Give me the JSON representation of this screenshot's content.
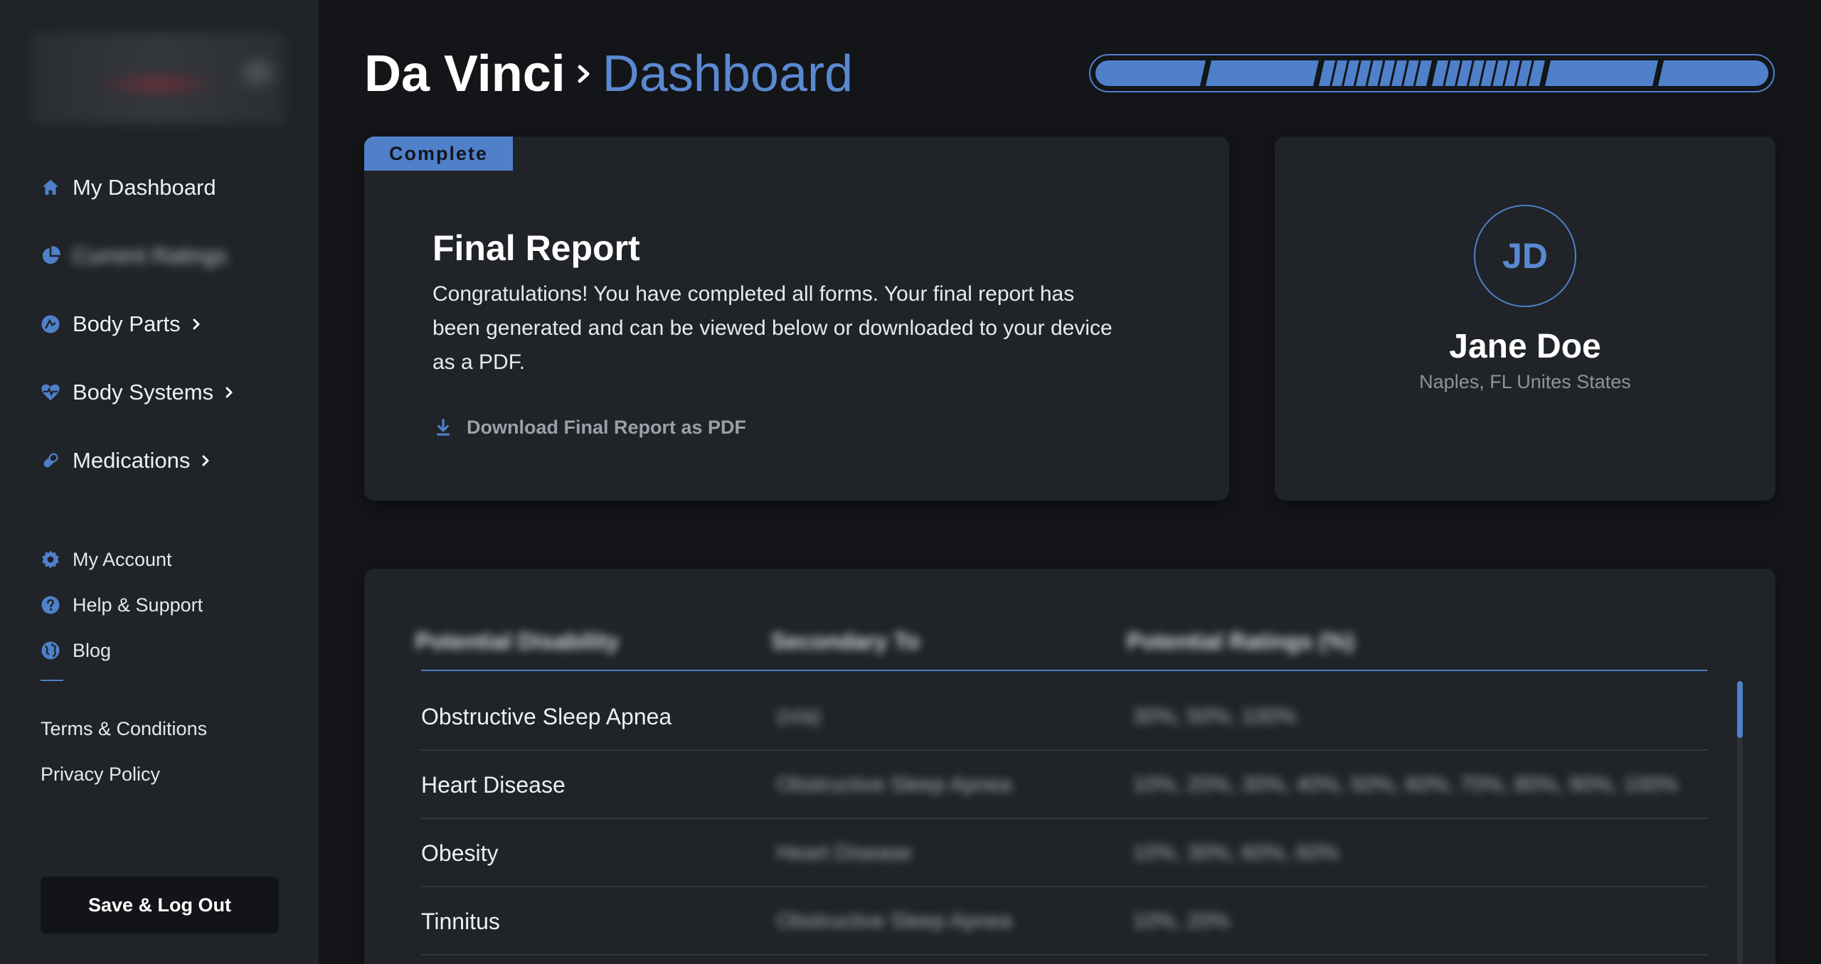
{
  "header": {
    "app_name": "Da Vinci",
    "page_name": "Dashboard",
    "progress_segments": 6,
    "progress_completed": 6
  },
  "sidebar": {
    "items": [
      {
        "label": "My Dashboard",
        "icon": "home-icon",
        "has_chevron": false
      },
      {
        "label": "Current Ratings",
        "icon": "pie-chart-icon",
        "has_chevron": false,
        "blurred": true
      },
      {
        "label": "Body Parts",
        "icon": "body-parts-icon",
        "has_chevron": true
      },
      {
        "label": "Body Systems",
        "icon": "heart-pulse-icon",
        "has_chevron": true
      },
      {
        "label": "Medications",
        "icon": "pill-icon",
        "has_chevron": true
      }
    ],
    "account_items": [
      {
        "label": "My Account",
        "icon": "gear-icon"
      },
      {
        "label": "Help & Support",
        "icon": "question-icon"
      },
      {
        "label": "Blog",
        "icon": "globe-icon"
      }
    ],
    "legal": {
      "terms": "Terms & Conditions",
      "privacy": "Privacy Policy"
    },
    "logout_label": "Save & Log Out"
  },
  "report": {
    "badge": "Complete",
    "title": "Final Report",
    "body": "Congratulations! You have completed all forms. Your final report has been generated and can be viewed below or downloaded to your device as a PDF.",
    "download_label": "Download Final Report as PDF"
  },
  "profile": {
    "initials": "JD",
    "name": "Jane Doe",
    "location": "Naples, FL Unites States"
  },
  "table": {
    "headers": [
      "Potential Disability",
      "Secondary To",
      "Potential Ratings (%)"
    ],
    "rows": [
      {
        "disability": "Obstructive Sleep Apnea",
        "secondary": "(n/a)",
        "ratings": "30%, 50%, 100%"
      },
      {
        "disability": "Heart Disease",
        "secondary": "Obstructive Sleep Apnea",
        "ratings": "10%, 20%, 30%, 40%, 50%, 60%, 70%, 80%, 90%, 100%"
      },
      {
        "disability": "Obesity",
        "secondary": "Heart Disease",
        "ratings": "10%, 30%, 60%, 60%"
      },
      {
        "disability": "Tinnitus",
        "secondary": "Obstructive Sleep Apnea",
        "ratings": "10%, 20%"
      }
    ]
  },
  "colors": {
    "accent": "#4f80c9",
    "background": "#131518",
    "panel": "#202327"
  }
}
